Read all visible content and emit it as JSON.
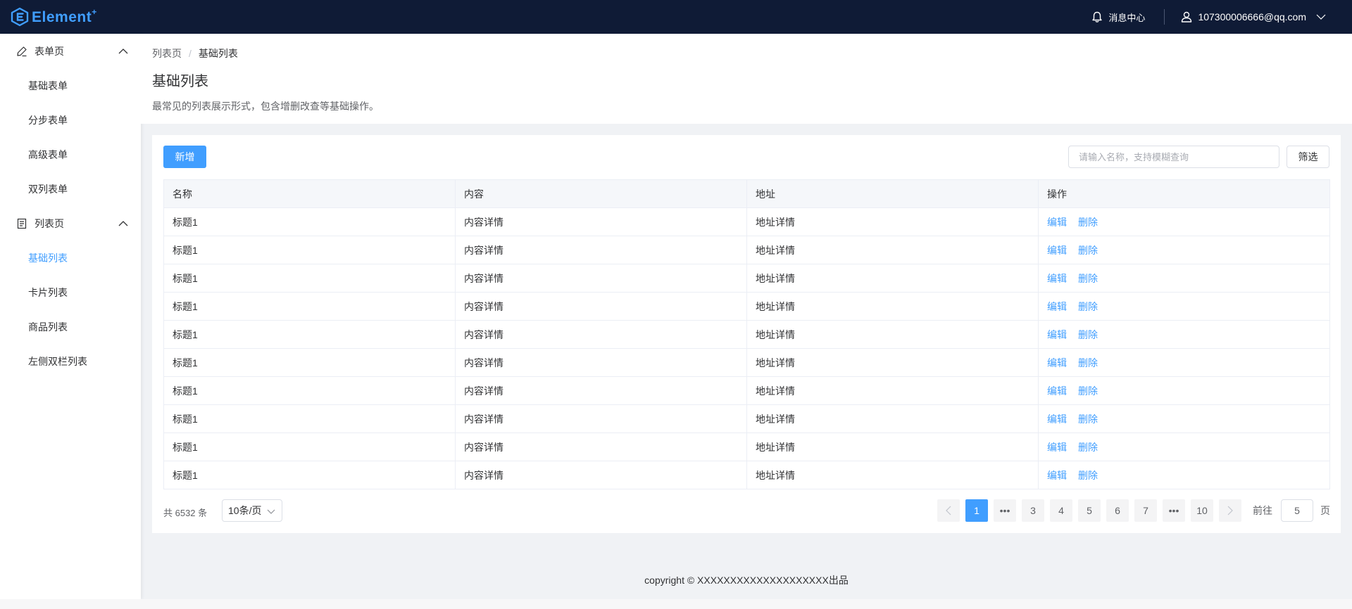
{
  "header": {
    "brand": "Element",
    "brand_sup": "+",
    "message_center": "消息中心",
    "user_email": "107300006666@qq.com",
    "bg_color": "#0f1b36"
  },
  "sidebar": {
    "groups": [
      {
        "label": "表单页",
        "icon": "edit-icon",
        "items": [
          "基础表单",
          "分步表单",
          "高级表单",
          "双列表单"
        ]
      },
      {
        "label": "列表页",
        "icon": "document-icon",
        "items": [
          "基础列表",
          "卡片列表",
          "商品列表",
          "左侧双栏列表"
        ]
      }
    ],
    "active_item": "基础列表"
  },
  "breadcrumb": [
    "列表页",
    "基础列表"
  ],
  "breadcrumb_separator": "/",
  "page": {
    "title": "基础列表",
    "description": "最常见的列表展示形式，包含增删改查等基础操作。"
  },
  "toolbar": {
    "add_label": "新增",
    "search_placeholder": "请输入名称，支持模糊查询",
    "filter_label": "筛选"
  },
  "table": {
    "columns": [
      "名称",
      "内容",
      "地址",
      "操作"
    ],
    "rows": [
      [
        "标题1",
        "内容详情",
        "地址详情"
      ],
      [
        "标题1",
        "内容详情",
        "地址详情"
      ],
      [
        "标题1",
        "内容详情",
        "地址详情"
      ],
      [
        "标题1",
        "内容详情",
        "地址详情"
      ],
      [
        "标题1",
        "内容详情",
        "地址详情"
      ],
      [
        "标题1",
        "内容详情",
        "地址详情"
      ],
      [
        "标题1",
        "内容详情",
        "地址详情"
      ],
      [
        "标题1",
        "内容详情",
        "地址详情"
      ],
      [
        "标题1",
        "内容详情",
        "地址详情"
      ],
      [
        "标题1",
        "内容详情",
        "地址详情"
      ]
    ],
    "edit_label": "编辑",
    "delete_label": "删除"
  },
  "pagination": {
    "total_text": "共 6532 条",
    "page_size": "10条/页",
    "pages": [
      "1",
      "•••",
      "3",
      "4",
      "5",
      "6",
      "7",
      "•••",
      "10"
    ],
    "current": "1",
    "goto_label": "前往",
    "goto_value": "5",
    "page_unit": "页"
  },
  "footer": {
    "copyright": "copyright  © XXXXXXXXXXXXXXXXXXXX出品"
  },
  "colors": {
    "accent": "#409eff",
    "page_bg": "#f0f2f5"
  }
}
